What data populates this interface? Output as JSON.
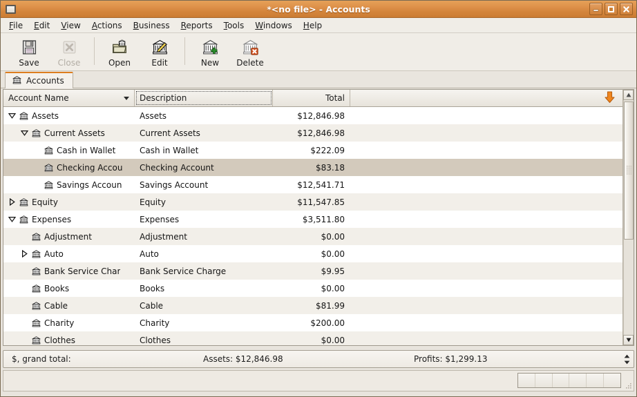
{
  "window": {
    "title": "*<no file> - Accounts",
    "buttons": {
      "minimize": "minimize",
      "maximize": "maximize",
      "close": "close"
    }
  },
  "menubar": {
    "items": [
      {
        "label": "File",
        "mnemonic": "F"
      },
      {
        "label": "Edit",
        "mnemonic": "E"
      },
      {
        "label": "View",
        "mnemonic": "V"
      },
      {
        "label": "Actions",
        "mnemonic": "A"
      },
      {
        "label": "Business",
        "mnemonic": "B"
      },
      {
        "label": "Reports",
        "mnemonic": "R"
      },
      {
        "label": "Tools",
        "mnemonic": "T"
      },
      {
        "label": "Windows",
        "mnemonic": "W"
      },
      {
        "label": "Help",
        "mnemonic": "H"
      }
    ]
  },
  "toolbar": {
    "items": [
      {
        "label": "Save",
        "icon": "floppy-disk-icon",
        "enabled": true
      },
      {
        "label": "Close",
        "icon": "close-x-icon",
        "enabled": false
      },
      {
        "label": "Open",
        "icon": "open-folder-icon",
        "enabled": true
      },
      {
        "label": "Edit",
        "icon": "edit-account-icon",
        "enabled": true
      },
      {
        "label": "New",
        "icon": "new-account-icon",
        "enabled": true
      },
      {
        "label": "Delete",
        "icon": "delete-account-icon",
        "enabled": true
      }
    ]
  },
  "tab": {
    "label": "Accounts",
    "icon": "bank-icon"
  },
  "columns": [
    {
      "key": "name",
      "label": "Account Name",
      "sort_indicator": "chevron-down-icon"
    },
    {
      "key": "desc",
      "label": "Description"
    },
    {
      "key": "total",
      "label": "Total"
    }
  ],
  "header_extra_icon": "down-arrow-icon",
  "rows": [
    {
      "name": "Assets",
      "desc": "Assets",
      "total": "$12,846.98",
      "depth": 0,
      "expander": "expanded",
      "selected": false
    },
    {
      "name": "Current Assets",
      "desc": "Current Assets",
      "total": "$12,846.98",
      "depth": 1,
      "expander": "expanded",
      "selected": false
    },
    {
      "name": "Cash in Wallet",
      "desc": "Cash in Wallet",
      "total": "$222.09",
      "depth": 2,
      "expander": "none",
      "selected": false
    },
    {
      "name": "Checking Accou",
      "desc": "Checking Account",
      "total": "$83.18",
      "depth": 2,
      "expander": "none",
      "selected": true
    },
    {
      "name": "Savings Accoun",
      "desc": "Savings Account",
      "total": "$12,541.71",
      "depth": 2,
      "expander": "none",
      "selected": false
    },
    {
      "name": "Equity",
      "desc": "Equity",
      "total": "$11,547.85",
      "depth": 0,
      "expander": "collapsed",
      "selected": false
    },
    {
      "name": "Expenses",
      "desc": "Expenses",
      "total": "$3,511.80",
      "depth": 0,
      "expander": "expanded",
      "selected": false
    },
    {
      "name": "Adjustment",
      "desc": "Adjustment",
      "total": "$0.00",
      "depth": 1,
      "expander": "none",
      "selected": false
    },
    {
      "name": "Auto",
      "desc": "Auto",
      "total": "$0.00",
      "depth": 1,
      "expander": "collapsed",
      "selected": false
    },
    {
      "name": "Bank Service Char",
      "desc": "Bank Service Charge",
      "total": "$9.95",
      "depth": 1,
      "expander": "none",
      "selected": false
    },
    {
      "name": "Books",
      "desc": "Books",
      "total": "$0.00",
      "depth": 1,
      "expander": "none",
      "selected": false
    },
    {
      "name": "Cable",
      "desc": "Cable",
      "total": "$81.99",
      "depth": 1,
      "expander": "none",
      "selected": false
    },
    {
      "name": "Charity",
      "desc": "Charity",
      "total": "$200.00",
      "depth": 1,
      "expander": "none",
      "selected": false
    },
    {
      "name": "Clothes",
      "desc": "Clothes",
      "total": "$0.00",
      "depth": 1,
      "expander": "none",
      "selected": false
    }
  ],
  "summary": {
    "grand_total_label": "$, grand total:",
    "assets": "Assets: $12,846.98",
    "profits": "Profits: $1,299.13"
  },
  "colors": {
    "titlebar": "#d4853c",
    "accent": "#dd7d1e",
    "selection": "#d3cabc",
    "row_odd": "#f2efe9",
    "row_even": "#ffffff",
    "chrome": "#f0ede7"
  }
}
